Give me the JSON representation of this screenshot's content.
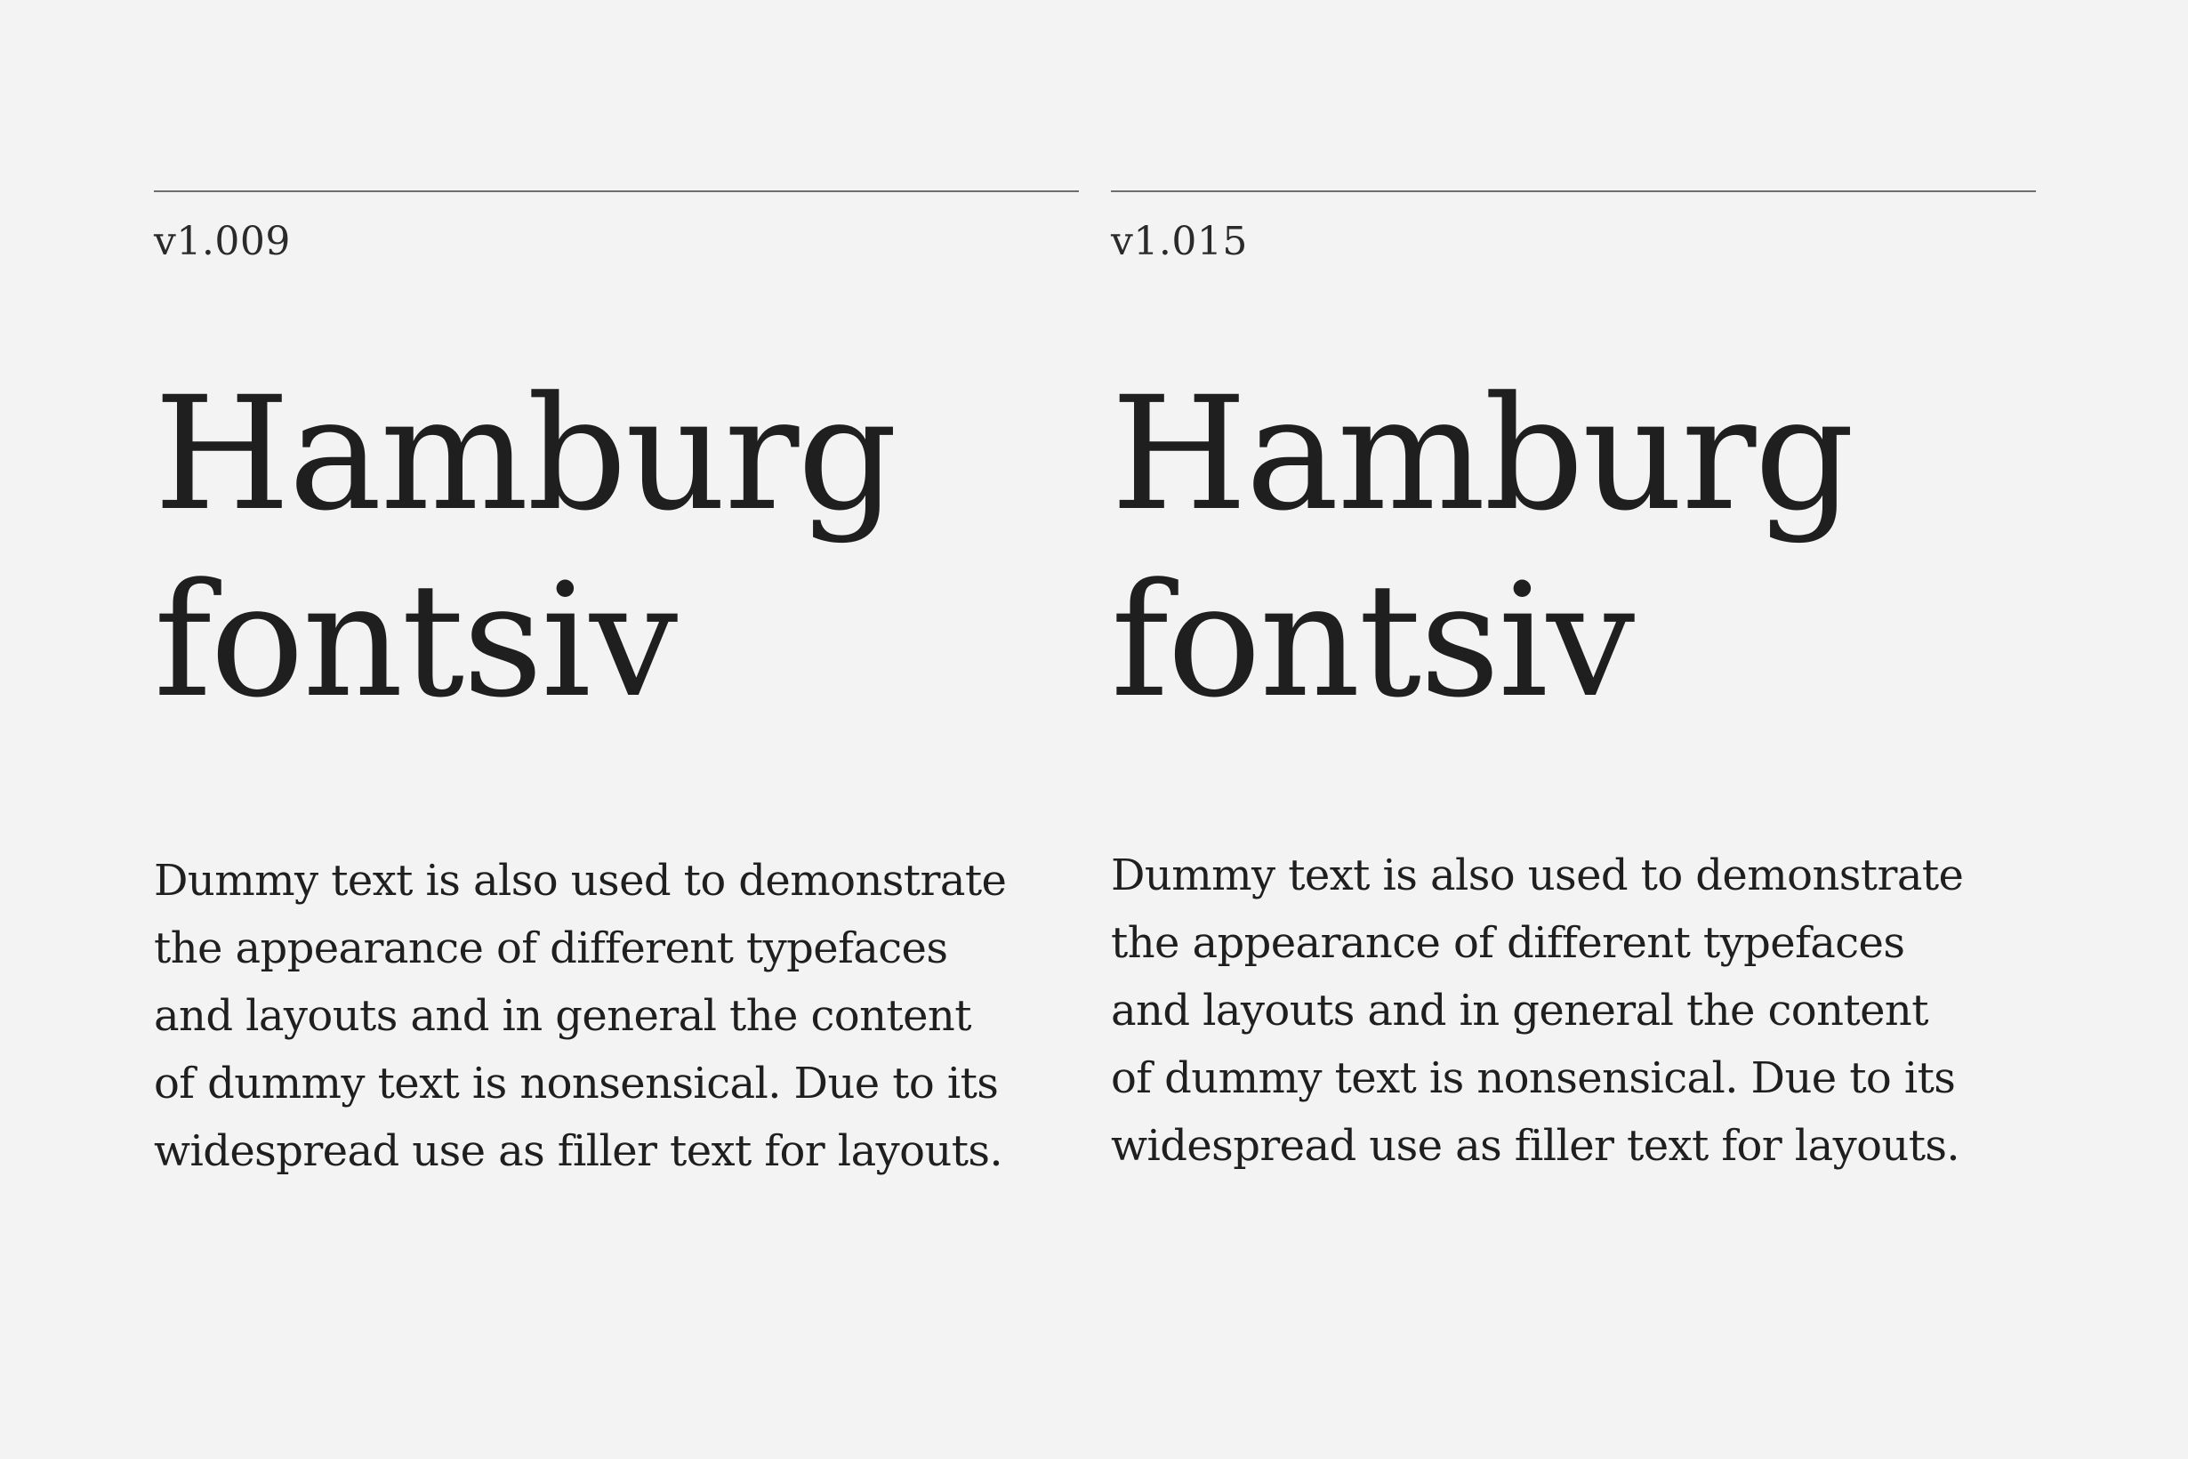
{
  "columns": [
    {
      "version": "v1.009",
      "display": [
        "Hamburg",
        "fontsiv"
      ],
      "body": [
        "Dummy text is also used to demonstrate",
        "the appearance of different typefaces",
        "and layouts and in general the content",
        "of dummy text is nonsensical. Due to its",
        "widespread use as filler text for layouts."
      ]
    },
    {
      "version": "v1.015",
      "display": [
        "Hamburg",
        "fontsiv"
      ],
      "body": [
        "Dummy text is also used to demonstrate",
        "the appearance of different typefaces",
        "and layouts and in general the content",
        "of dummy text is nonsensical. Due to its",
        "widespread use as filler text for layouts."
      ]
    }
  ]
}
